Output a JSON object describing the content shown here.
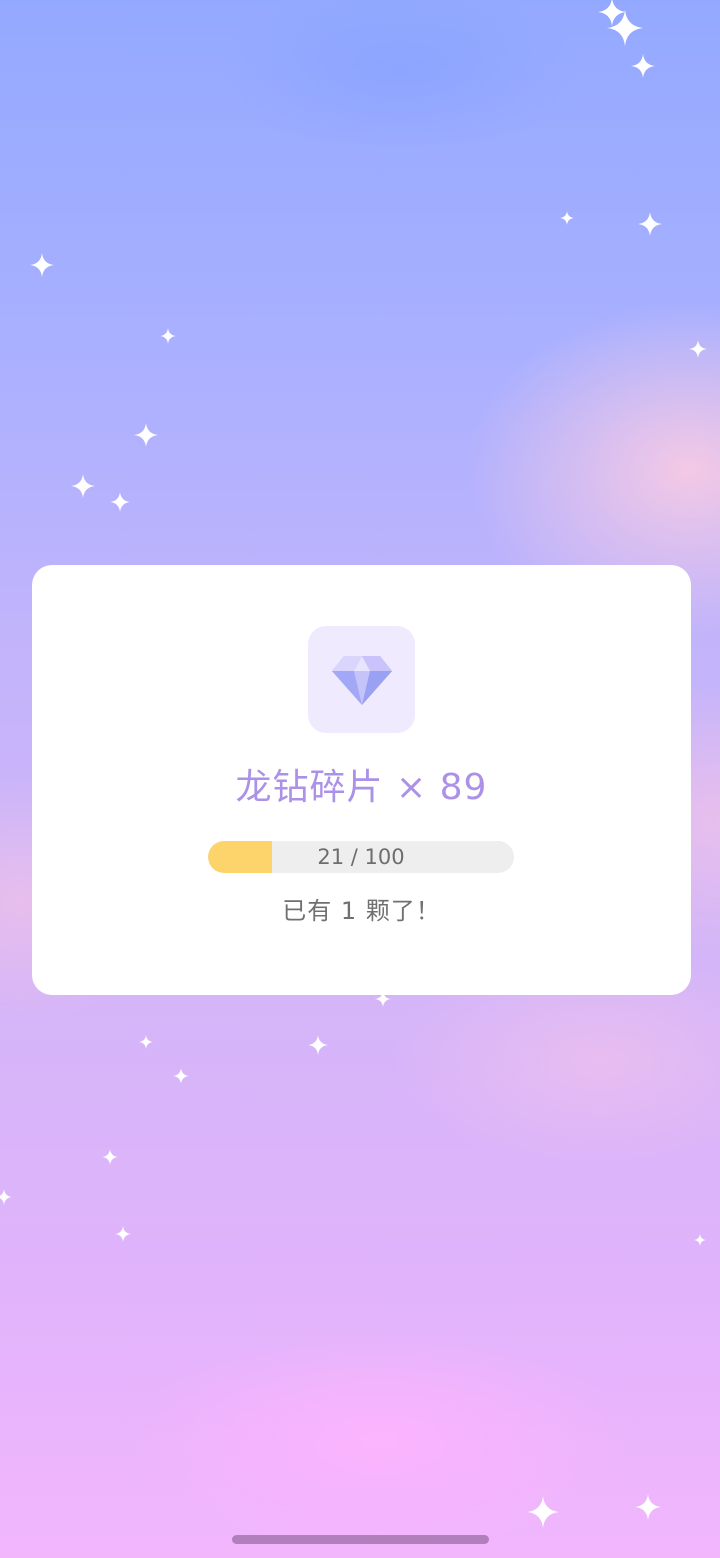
{
  "reward": {
    "item_name": "龙钻碎片",
    "quantity_text": "× 89",
    "progress": {
      "current": 21,
      "total": 100,
      "label": "21 / 100"
    },
    "status_text": "已有 1 颗了！"
  },
  "icons": {
    "reward_icon": "diamond-icon",
    "decorations": "sparkle-icon"
  },
  "colors": {
    "title": "#ab91e8",
    "progress_fill": "#fdd36c",
    "progress_track": "#eeeeee",
    "card_bg": "#ffffff",
    "gem_tile_bg": "#efeafd"
  }
}
